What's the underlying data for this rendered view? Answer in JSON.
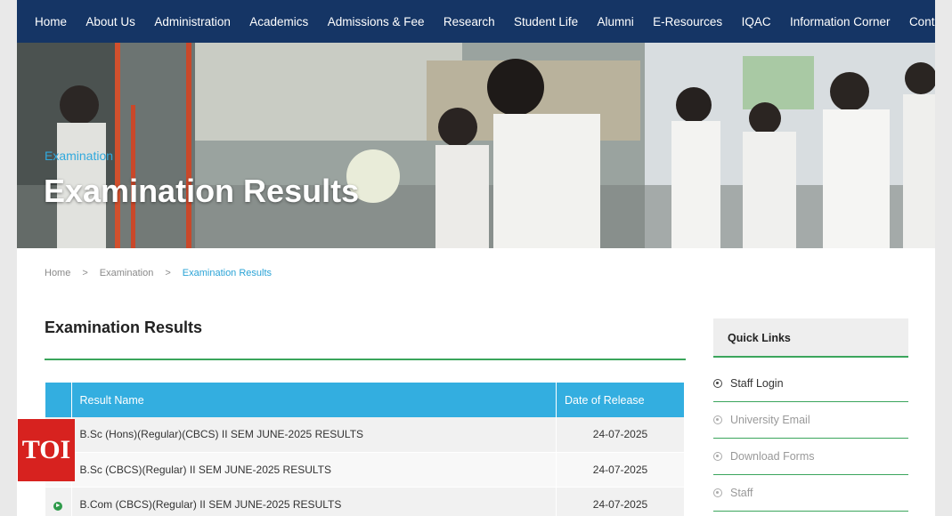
{
  "nav": {
    "items": [
      "Home",
      "About Us",
      "Administration",
      "Academics",
      "Admissions & Fee",
      "Research",
      "Student Life",
      "Alumni",
      "E-Resources",
      "IQAC",
      "Information Corner",
      "Contact Us"
    ]
  },
  "hero": {
    "kicker": "Examination",
    "title": "Examination Results"
  },
  "breadcrumb": {
    "home": "Home",
    "separator": ">",
    "section": "Examination",
    "current": "Examination Results"
  },
  "main": {
    "title": "Examination Results",
    "table": {
      "headers": [
        "",
        "Result Name",
        "Date of Release"
      ],
      "rows": [
        {
          "name": "B.Sc (Hons)(Regular)(CBCS) II SEM JUNE-2025 RESULTS",
          "date": "24-07-2025",
          "icon": ""
        },
        {
          "name": "B.Sc (CBCS)(Regular) II SEM JUNE-2025 RESULTS",
          "date": "24-07-2025",
          "icon": ""
        },
        {
          "name": "B.Com (CBCS)(Regular) II SEM JUNE-2025 RESULTS",
          "date": "24-07-2025",
          "icon": "arrow-right-circle-icon"
        }
      ]
    }
  },
  "sidebar": {
    "title": "Quick Links",
    "items": [
      "Staff Login",
      "University Email",
      "Download Forms",
      "Staff"
    ]
  },
  "watermark": {
    "text": "TOI"
  },
  "colors": {
    "nav_bg": "#153565",
    "accent_blue": "#33aee0",
    "accent_green": "#3ba55c",
    "watermark_red": "#d7221f"
  }
}
